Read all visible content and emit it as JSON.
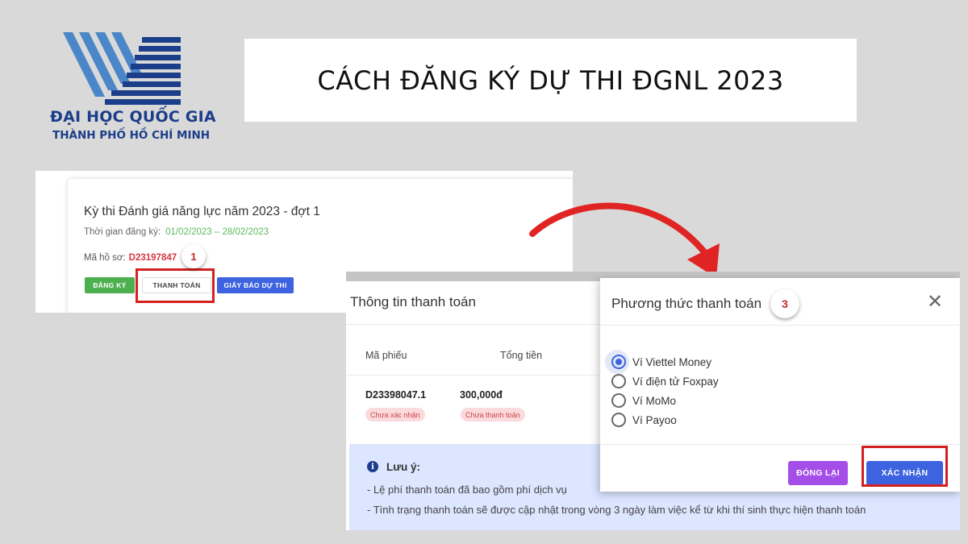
{
  "logo": {
    "line1": "ĐẠI HỌC QUỐC GIA",
    "line2": "THÀNH PHỐ HỒ CHÍ MINH",
    "colors": {
      "light_blue": "#4a86c8",
      "navy": "#1b3e8a"
    }
  },
  "title": "CÁCH ĐĂNG KÝ DỰ THI ĐGNL 2023",
  "exam_card": {
    "title": "Kỳ thi Đánh giá năng lực năm 2023 - đợt 1",
    "reg_label": "Thời gian đăng ký:",
    "reg_value": "01/02/2023 – 28/02/2023",
    "code_label": "Mã hồ sơ:",
    "code_value": "D23197847",
    "buttons": {
      "register": "ĐĂNG KÝ",
      "pay": "THANH TOÁN",
      "notice": "GIẤY BÁO DỰ THI"
    },
    "step": "1"
  },
  "payment_info": {
    "title": "Thông tin thanh toán",
    "columns": [
      "Mã phiếu",
      "Tổng tiền"
    ],
    "row": {
      "code": "D23398047.1",
      "amount": "300,000đ",
      "status_confirm": "Chưa xác nhận",
      "status_pay": "Chưa thanh toán"
    },
    "note": {
      "title": "Lưu ý:",
      "lines": [
        "- Lệ phí thanh toán đã bao gồm phí dịch vụ",
        "- Tình trạng thanh toán sẽ được cập nhật trong vòng 3 ngày làm việc kể từ khi thí sinh thực hiện thanh toán"
      ]
    }
  },
  "payment_method": {
    "title": "Phương thức thanh toán",
    "step": "3",
    "options": [
      "Ví Viettel Money",
      "Ví điện tử Foxpay",
      "Ví MoMo",
      "Ví Payoo"
    ],
    "selected": "Ví Viettel Money",
    "buttons": {
      "close": "ĐÓNG LẠI",
      "confirm": "XÁC NHẬN"
    }
  },
  "colors": {
    "highlight": "#d32020",
    "primary": "#3d63e0",
    "green": "#4caf50",
    "purple": "#a44de8"
  }
}
